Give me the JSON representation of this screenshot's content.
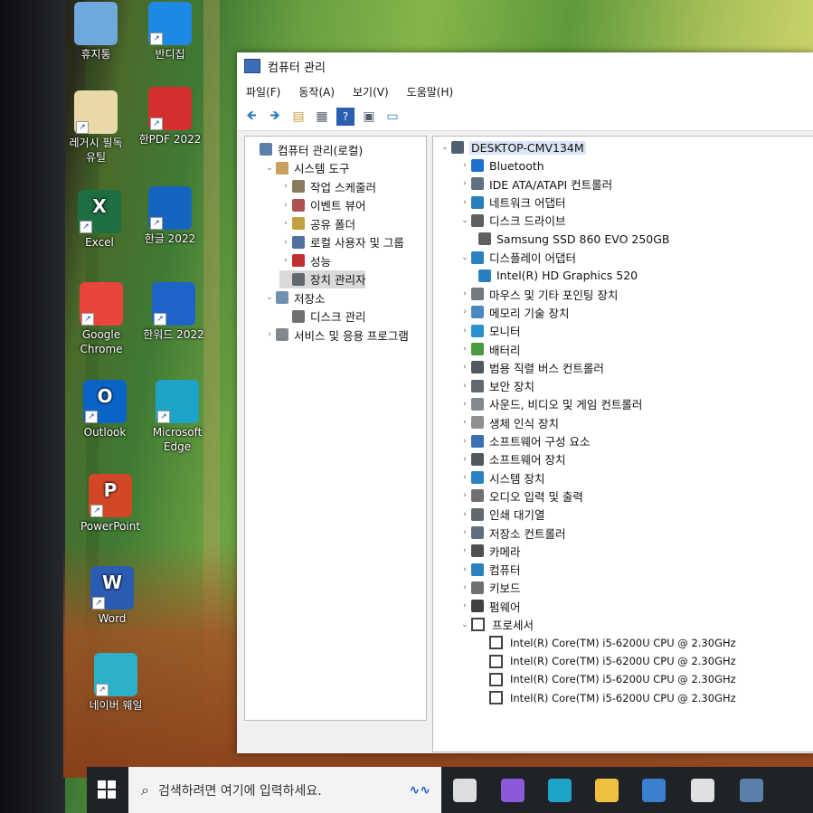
{
  "desktop": {
    "icons": [
      {
        "label": "휴지통",
        "name": "recycle-bin-icon",
        "color": "#6fa8dc"
      },
      {
        "label": "반디집",
        "name": "bandizip-icon",
        "color": "#1e88e5"
      },
      {
        "label": "레거시 필독\n유틸",
        "name": "legacy-utils-icon",
        "color": "#e9d9a8"
      },
      {
        "label": "한PDF 2022",
        "name": "hanpdf-icon",
        "color": "#d32f2f"
      },
      {
        "label": "Excel",
        "name": "excel-icon",
        "color": "#1d6f42",
        "glyph": "X"
      },
      {
        "label": "한글 2022",
        "name": "hangul-icon",
        "color": "#1565c0"
      },
      {
        "label": "Google\nChrome",
        "name": "chrome-icon",
        "color": "#e8453c"
      },
      {
        "label": "한워드 2022",
        "name": "hanword-icon",
        "color": "#1e63c8"
      },
      {
        "label": "Outlook",
        "name": "outlook-icon",
        "color": "#0a64c8",
        "glyph": "O"
      },
      {
        "label": "Microsoft\nEdge",
        "name": "edge-icon",
        "color": "#1fa4c9"
      },
      {
        "label": "PowerPoint",
        "name": "powerpoint-icon",
        "color": "#d24726",
        "glyph": "P"
      },
      {
        "label": "Word",
        "name": "word-icon",
        "color": "#2b5cb3",
        "glyph": "W"
      },
      {
        "label": "네이버 웨일",
        "name": "naver-whale-icon",
        "color": "#2ab0c8"
      }
    ]
  },
  "window": {
    "title": "컴퓨터 관리",
    "menu": [
      "파일(F)",
      "동작(A)",
      "보기(V)",
      "도움말(H)"
    ],
    "toolbar_icons": [
      "back-arrow-icon",
      "forward-arrow-icon",
      "up-folder-icon",
      "show-hide-tree-icon",
      "help-icon",
      "properties-icon",
      "monitor-icon"
    ]
  },
  "left_tree": [
    {
      "label": "컴퓨터 관리(로컬)",
      "indent": 0,
      "expander": "",
      "icon": "computer-management-icon",
      "color": "#5a7fa8"
    },
    {
      "label": "시스템 도구",
      "indent": 1,
      "expander": "⌄",
      "icon": "system-tools-icon",
      "color": "#c8a060"
    },
    {
      "label": "작업 스케줄러",
      "indent": 2,
      "expander": "›",
      "icon": "task-scheduler-icon",
      "color": "#8a7a60"
    },
    {
      "label": "이벤트 뷰어",
      "indent": 2,
      "expander": "›",
      "icon": "event-viewer-icon",
      "color": "#b05050"
    },
    {
      "label": "공유 폴더",
      "indent": 2,
      "expander": "›",
      "icon": "shared-folders-icon",
      "color": "#c0a040"
    },
    {
      "label": "로컬 사용자 및 그룹",
      "indent": 2,
      "expander": "›",
      "icon": "local-users-icon",
      "color": "#5070a0"
    },
    {
      "label": "성능",
      "indent": 2,
      "expander": "›",
      "icon": "performance-icon",
      "color": "#c03030"
    },
    {
      "label": "장치 관리자",
      "indent": 2,
      "expander": "",
      "icon": "device-manager-icon",
      "color": "#606870",
      "selected": true
    },
    {
      "label": "저장소",
      "indent": 1,
      "expander": "⌄",
      "icon": "storage-icon",
      "color": "#7090b0"
    },
    {
      "label": "디스크 관리",
      "indent": 2,
      "expander": "",
      "icon": "disk-management-icon",
      "color": "#707070"
    },
    {
      "label": "서비스 및 응용 프로그램",
      "indent": 1,
      "expander": "›",
      "icon": "services-icon",
      "color": "#808890"
    }
  ],
  "device_tree": {
    "root": "DESKTOP-CMV134M",
    "items": [
      {
        "label": "Bluetooth",
        "type": "category",
        "expander": "›",
        "icon": "bluetooth-icon",
        "color": "#1e6fd0"
      },
      {
        "label": "IDE ATA/ATAPI 컨트롤러",
        "type": "category",
        "expander": "›",
        "icon": "ide-controller-icon",
        "color": "#607080"
      },
      {
        "label": "네트워크 어댑터",
        "type": "category",
        "expander": "›",
        "icon": "network-adapter-icon",
        "color": "#2a7fc0"
      },
      {
        "label": "디스크 드라이브",
        "type": "category",
        "expander": "⌄",
        "icon": "disk-drive-icon",
        "color": "#606060"
      },
      {
        "label": "Samsung SSD 860 EVO 250GB",
        "type": "device",
        "icon": "disk-device-icon",
        "color": "#606060"
      },
      {
        "label": "디스플레이 어댑터",
        "type": "category",
        "expander": "⌄",
        "icon": "display-adapter-icon",
        "color": "#2a7fc0"
      },
      {
        "label": "Intel(R) HD Graphics 520",
        "type": "device",
        "icon": "display-device-icon",
        "color": "#2a7fc0"
      },
      {
        "label": "마우스 및 기타 포인팅 장치",
        "type": "category",
        "expander": "›",
        "icon": "mouse-icon",
        "color": "#707880"
      },
      {
        "label": "메모리 기술 장치",
        "type": "category",
        "expander": "›",
        "icon": "memory-icon",
        "color": "#4a8ac0"
      },
      {
        "label": "모니터",
        "type": "category",
        "expander": "›",
        "icon": "monitor-device-icon",
        "color": "#2a90d0"
      },
      {
        "label": "배터리",
        "type": "category",
        "expander": "›",
        "icon": "battery-icon",
        "color": "#4a9a40"
      },
      {
        "label": "범용 직렬 버스 컨트롤러",
        "type": "category",
        "expander": "›",
        "icon": "usb-icon",
        "color": "#505860"
      },
      {
        "label": "보안 장치",
        "type": "category",
        "expander": "›",
        "icon": "security-device-icon",
        "color": "#606870"
      },
      {
        "label": "사운드, 비디오 및 게임 컨트롤러",
        "type": "category",
        "expander": "›",
        "icon": "sound-icon",
        "color": "#808890"
      },
      {
        "label": "생체 인식 장치",
        "type": "category",
        "expander": "›",
        "icon": "biometric-icon",
        "color": "#909090"
      },
      {
        "label": "소프트웨어 구성 요소",
        "type": "category",
        "expander": "›",
        "icon": "software-component-icon",
        "color": "#3a6fb0"
      },
      {
        "label": "소프트웨어 장치",
        "type": "category",
        "expander": "›",
        "icon": "software-device-icon",
        "color": "#505860"
      },
      {
        "label": "시스템 장치",
        "type": "category",
        "expander": "›",
        "icon": "system-device-icon",
        "color": "#2a80c0"
      },
      {
        "label": "오디오 입력 및 출력",
        "type": "category",
        "expander": "›",
        "icon": "audio-io-icon",
        "color": "#707070"
      },
      {
        "label": "인쇄 대기열",
        "type": "category",
        "expander": "›",
        "icon": "print-queue-icon",
        "color": "#606870"
      },
      {
        "label": "저장소 컨트롤러",
        "type": "category",
        "expander": "›",
        "icon": "storage-controller-icon",
        "color": "#607080"
      },
      {
        "label": "카메라",
        "type": "category",
        "expander": "›",
        "icon": "camera-icon",
        "color": "#505050"
      },
      {
        "label": "컴퓨터",
        "type": "category",
        "expander": "›",
        "icon": "computer-icon",
        "color": "#2a80c0"
      },
      {
        "label": "키보드",
        "type": "category",
        "expander": "›",
        "icon": "keyboard-icon",
        "color": "#707070"
      },
      {
        "label": "펌웨어",
        "type": "category",
        "expander": "›",
        "icon": "firmware-icon",
        "color": "#404040"
      },
      {
        "label": "프로세서",
        "type": "category",
        "expander": "⌄",
        "icon": "processor-icon",
        "color": "#404040"
      },
      {
        "label": "Intel(R) Core(TM) i5-6200U CPU @ 2.30GHz",
        "type": "cpu",
        "icon": "cpu-icon",
        "color": "#404040"
      },
      {
        "label": "Intel(R) Core(TM) i5-6200U CPU @ 2.30GHz",
        "type": "cpu",
        "icon": "cpu-icon",
        "color": "#404040"
      },
      {
        "label": "Intel(R) Core(TM) i5-6200U CPU @ 2.30GHz",
        "type": "cpu",
        "icon": "cpu-icon",
        "color": "#404040"
      },
      {
        "label": "Intel(R) Core(TM) i5-6200U CPU @ 2.30GHz",
        "type": "cpu",
        "icon": "cpu-icon",
        "color": "#404040"
      }
    ]
  },
  "taskbar": {
    "search_placeholder": "검색하려면 여기에 입력하세요.",
    "icons": [
      {
        "name": "task-view-icon",
        "color": "#dddddd"
      },
      {
        "name": "copilot-icon",
        "color": "#8a5ad8"
      },
      {
        "name": "edge-taskbar-icon",
        "color": "#1fa4c9"
      },
      {
        "name": "file-explorer-icon",
        "color": "#f0c040"
      },
      {
        "name": "store-icon",
        "color": "#3a7fd0"
      },
      {
        "name": "mail-icon",
        "color": "#e0e0e0"
      },
      {
        "name": "computer-management-taskbar-icon",
        "color": "#5a7fa8"
      }
    ]
  }
}
